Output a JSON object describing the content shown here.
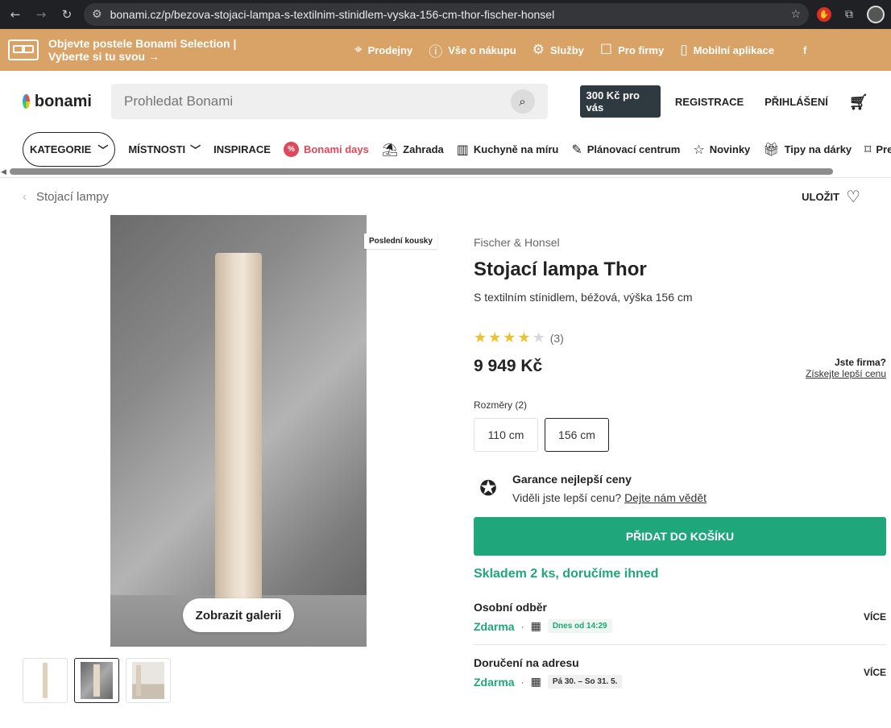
{
  "browser": {
    "url": "bonami.cz/p/bezova-stojaci-lampa-s-textilnim-stinidlem-vyska-156-cm-thor-fischer-honsel"
  },
  "promo": {
    "line1": "Objevte postele Bonami Selection |",
    "line2": "Vyberte si tu svou →",
    "links": [
      {
        "label": "Prodejny",
        "icon": "location-pin-icon"
      },
      {
        "label": "Vše o nákupu",
        "icon": "info-icon"
      },
      {
        "label": "Služby",
        "icon": "gear-icon"
      },
      {
        "label": "Pro firmy",
        "icon": "id-card-icon"
      },
      {
        "label": "Mobilní aplikace",
        "icon": "phone-icon"
      }
    ],
    "social": "f"
  },
  "header": {
    "logo_text": "bonami",
    "search_placeholder": "Prohledat Bonami",
    "badge": "300 Kč pro vás",
    "register": "REGISTRACE",
    "login": "PŘIHLÁŠENÍ"
  },
  "nav": {
    "kategorie": "KATEGORIE",
    "mistnosti": "MÍSTNOSTI",
    "inspirace": "INSPIRACE",
    "bonami_days": "Bonami days",
    "pct_symbol": "%",
    "zahrada": "Zahrada",
    "kuchyne": "Kuchyně na míru",
    "planovaci": "Plánovací centrum",
    "novinky": "Novinky",
    "tipy": "Tipy na dárky",
    "premium": "Prem"
  },
  "breadcrumb": {
    "back_label": "Stojací lampy",
    "save_label": "ULOŽIT"
  },
  "gallery": {
    "badge": "Poslední kousky",
    "button": "Zobrazit galerii"
  },
  "product": {
    "brand": "Fischer & Honsel",
    "title": "Stojací lampa Thor",
    "subtitle": "S textilním stínidlem, béžová, výška 156 cm",
    "rating_value": 4,
    "rating_max": 5,
    "rating_count": "(3)",
    "price": "9 949 Kč",
    "firm_title": "Jste firma?",
    "firm_link": "Získejte lepší cenu",
    "dimensions_label": "Rozměry (2)",
    "dimensions": [
      "110 cm",
      "156 cm"
    ],
    "selected_dimension": "156 cm",
    "guarantee_title": "Garance nejlepší ceny",
    "guarantee_text": "Viděli jste lepší cenu?",
    "guarantee_link": "Dejte nám vědět",
    "add_to_cart": "PŘIDAT DO KOŠÍKU",
    "stock": "Skladem 2 ks, doručíme ihned"
  },
  "delivery": [
    {
      "title": "Osobní odběr",
      "price": "Zdarma",
      "date": "Dnes od 14:29",
      "more": "VÍCE"
    },
    {
      "title": "Doručení na adresu",
      "price": "Zdarma",
      "date": "Pá 30. – So 31. 5.",
      "more": "VÍCE"
    }
  ]
}
